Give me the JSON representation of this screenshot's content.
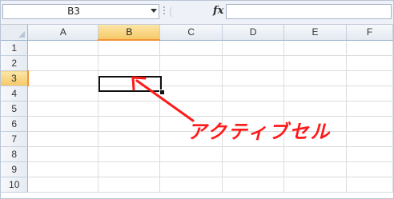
{
  "formula_bar": {
    "name_box": "B3",
    "fx_label": "fx",
    "formula_value": ""
  },
  "columns": [
    "A",
    "B",
    "C",
    "D",
    "E",
    "F"
  ],
  "rows": [
    "1",
    "2",
    "3",
    "4",
    "5",
    "6",
    "7",
    "8",
    "9",
    "10"
  ],
  "active_cell": {
    "column": "B",
    "row": "3"
  },
  "annotation": {
    "label": "アクティブセル",
    "color": "#ff1a1a"
  },
  "colors": {
    "active_header": "#f6c867",
    "header_bg": "#e8edf4",
    "gridline": "#dadcdd"
  }
}
